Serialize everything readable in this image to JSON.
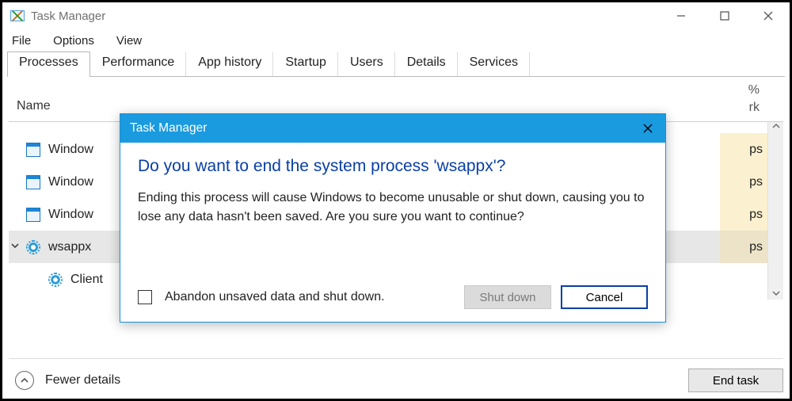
{
  "window": {
    "title": "Task Manager",
    "menus": [
      "File",
      "Options",
      "View"
    ],
    "win_controls": {
      "min": "minimize",
      "max": "maximize",
      "close": "close"
    }
  },
  "tabs": [
    {
      "label": "Processes",
      "active": true
    },
    {
      "label": "Performance",
      "active": false
    },
    {
      "label": "App history",
      "active": false
    },
    {
      "label": "Startup",
      "active": false
    },
    {
      "label": "Users",
      "active": false
    },
    {
      "label": "Details",
      "active": false
    },
    {
      "label": "Services",
      "active": false
    }
  ],
  "columns": {
    "name": "Name",
    "right_pct": "%",
    "right_label": "rk"
  },
  "rows": [
    {
      "label": "Window",
      "icon": "window",
      "value": "ps"
    },
    {
      "label": "Window",
      "icon": "window",
      "value": "ps"
    },
    {
      "label": "Window",
      "icon": "window",
      "value": "ps"
    },
    {
      "label": "wsappx",
      "icon": "gear",
      "value": "ps",
      "expanded": true,
      "selected": true
    },
    {
      "label": "Client",
      "icon": "gear-sub",
      "value": "",
      "child": true
    }
  ],
  "footer": {
    "fewer_label": "Fewer details",
    "end_task_label": "End task"
  },
  "dialog": {
    "title": "Task Manager",
    "headline": "Do you want to end the system process 'wsappx'?",
    "body": "Ending this process will cause Windows to become unusable or shut down, causing you to lose any data hasn't been saved. Are you sure you want to continue?",
    "checkbox_label": "Abandon unsaved data and shut down.",
    "shutdown_label": "Shut down",
    "cancel_label": "Cancel"
  }
}
